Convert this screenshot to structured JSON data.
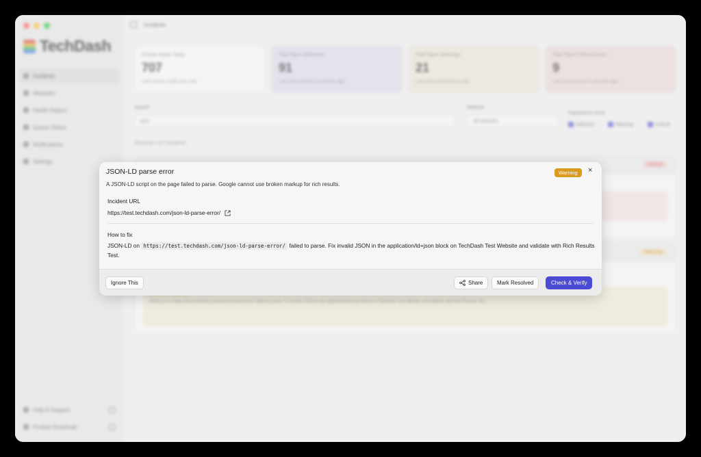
{
  "app": {
    "logo_text": "TechDash",
    "breadcrumb": "Incidents"
  },
  "sidebar": {
    "items": [
      {
        "label": "Incidents",
        "active": true
      },
      {
        "label": "Websites"
      },
      {
        "label": "Health Report"
      },
      {
        "label": "Queue Status"
      },
      {
        "label": "Notifications"
      },
      {
        "label": "Settings"
      }
    ],
    "bottom": [
      {
        "label": "Help & Support"
      },
      {
        "label": "Product Roadmap"
      }
    ]
  },
  "stats": [
    {
      "label": "Checks Made Today",
      "value": "707",
      "sub": "Last check made just now"
    },
    {
      "label": "Total Open Advisories",
      "value": "91",
      "sub": "Last issue found 3 minutes ago"
    },
    {
      "label": "Total Open Warnings",
      "value": "21",
      "sub": "Last issue found just now"
    },
    {
      "label": "Total Open Critical Issues",
      "value": "9",
      "sub": "Last issue found 3 minutes ago"
    }
  ],
  "filters": {
    "search_label": "Search",
    "search_value": "json",
    "website_label": "Website",
    "website_value": "All websites",
    "importance_label": "Importance Level",
    "levels": [
      "Advisory",
      "Warning",
      "Critical"
    ]
  },
  "list": {
    "showing": "Showing 2 of 2 incidents",
    "tags": [
      "Critical",
      "Warning"
    ],
    "inc2_time": "Detected 1 minute ago",
    "inc2_text": "JSON-LD on https://test.techdash.com/json-ld-parse-error/ failed to parse. Fix invalid JSON in the application/ld+json block on TechDash Test Website and validate with Rich Results Test."
  },
  "dialog": {
    "title": "JSON-LD parse error",
    "badge": "Warning",
    "close": "×",
    "description": "A JSON-LD script on the page failed to parse. Google cannot use broken markup for rich results.",
    "url_heading": "Incident URL",
    "url": "https://test.techdash.com/json-ld-parse-error/",
    "fix_heading": "How to fix",
    "fix_pre": "JSON-LD on",
    "fix_code": "https://test.techdash.com/json-ld-parse-error/",
    "fix_post": "failed to parse. Fix invalid JSON in the application/ld+json block on TechDash Test Website and validate with Rich Results Test.",
    "buttons": {
      "ignore": "Ignore This",
      "share": "Share",
      "resolve": "Mark Resolved",
      "verify": "Check & Verify"
    }
  },
  "colors": {
    "accent": "#4a4ad4",
    "warning": "#d99a1e"
  }
}
